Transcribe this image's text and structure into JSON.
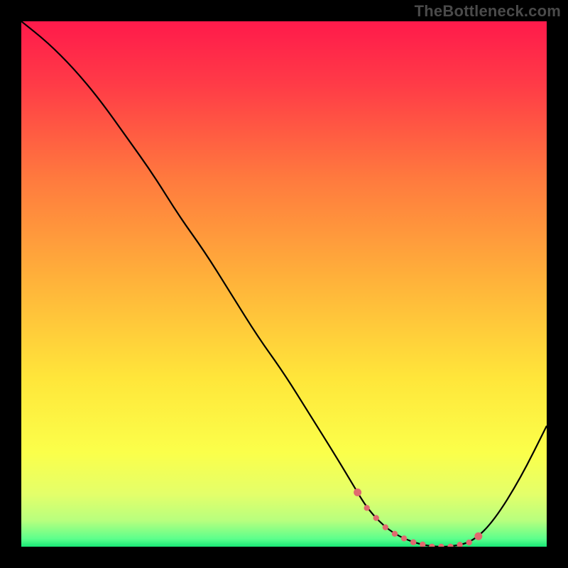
{
  "watermark": "TheBottleneck.com",
  "chart_data": {
    "type": "line",
    "title": "",
    "xlabel": "",
    "ylabel": "",
    "xlim": [
      0,
      100
    ],
    "ylim": [
      0,
      100
    ],
    "series": [
      {
        "name": "bottleneck-curve",
        "x": [
          0,
          5,
          10,
          15,
          20,
          25,
          30,
          35,
          40,
          45,
          50,
          55,
          60,
          63,
          66,
          70,
          74,
          78,
          82,
          86,
          90,
          95,
          100
        ],
        "y": [
          100,
          96,
          91,
          85,
          78,
          71,
          63,
          56,
          48,
          40,
          33,
          25,
          17,
          12,
          7,
          3,
          1,
          0,
          0,
          1,
          5,
          13,
          23
        ]
      }
    ],
    "optimal_band": {
      "start_x": 64,
      "end_x": 87
    },
    "gradient_stops": [
      {
        "offset": 0.0,
        "color": "#ff1a4b"
      },
      {
        "offset": 0.12,
        "color": "#ff3b47"
      },
      {
        "offset": 0.3,
        "color": "#ff7a3e"
      },
      {
        "offset": 0.5,
        "color": "#ffb43a"
      },
      {
        "offset": 0.68,
        "color": "#ffe63a"
      },
      {
        "offset": 0.82,
        "color": "#fbff4a"
      },
      {
        "offset": 0.9,
        "color": "#e4ff6a"
      },
      {
        "offset": 0.95,
        "color": "#b8ff7e"
      },
      {
        "offset": 0.985,
        "color": "#5cff8c"
      },
      {
        "offset": 1.0,
        "color": "#19e876"
      }
    ],
    "marker_color": "#e06a6f",
    "curve_color": "#000000"
  }
}
